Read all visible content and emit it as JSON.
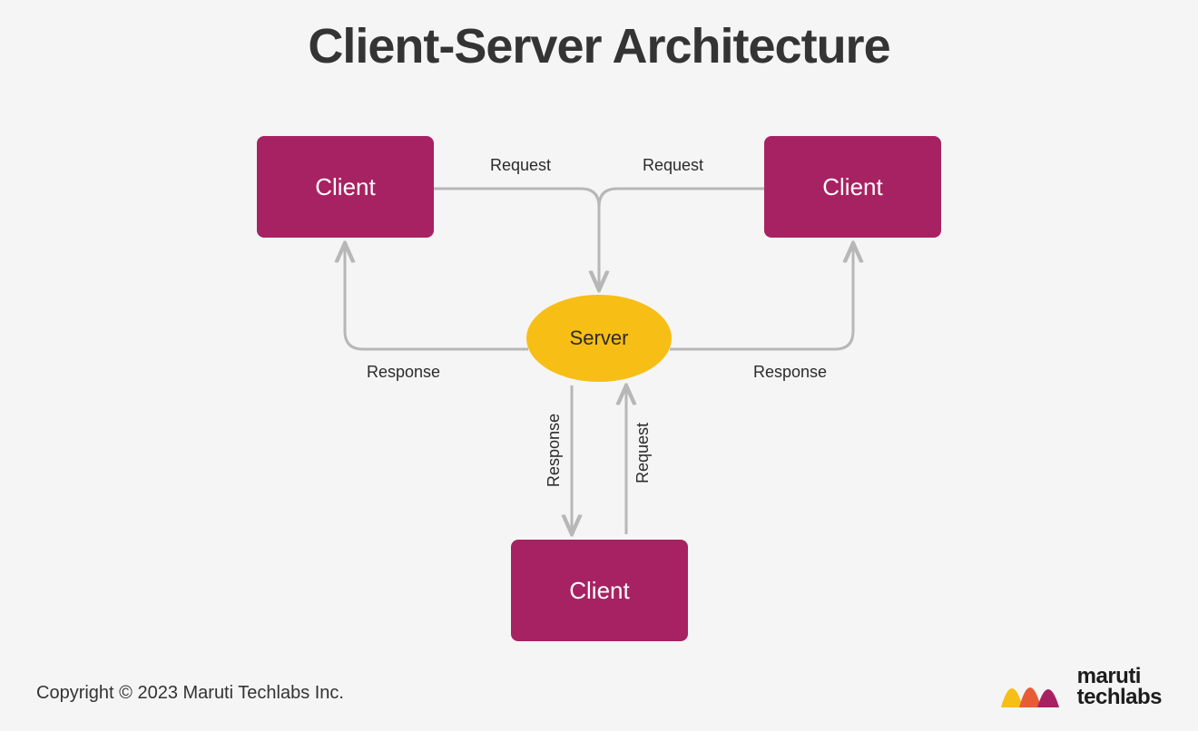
{
  "title": "Client-Server Architecture",
  "nodes": {
    "client_tl": "Client",
    "client_tr": "Client",
    "client_b": "Client",
    "server": "Server"
  },
  "edges": {
    "tl_request": "Request",
    "tr_request": "Request",
    "tl_response": "Response",
    "tr_response": "Response",
    "b_request": "Request",
    "b_response": "Response"
  },
  "colors": {
    "client_fill": "#a72262",
    "server_fill": "#f7be15",
    "arrow": "#b7b7b7",
    "bg": "#f5f5f5",
    "text_dark": "#343434"
  },
  "copyright": "Copyright © 2023 Maruti Techlabs Inc.",
  "brand": {
    "line1": "maruti",
    "line2": "techlabs"
  }
}
